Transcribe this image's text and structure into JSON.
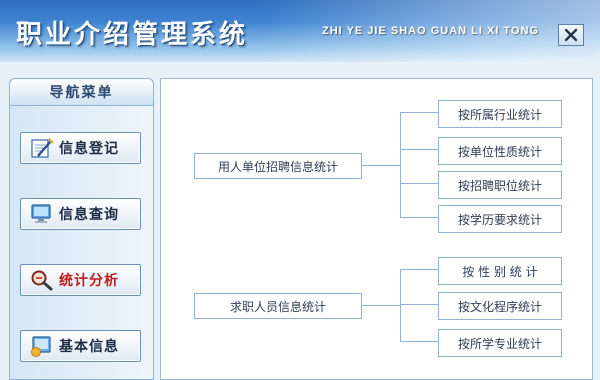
{
  "header": {
    "title": "职业介绍管理系统",
    "subtitle": "ZHI YE JIE SHAO GUAN LI XI TONG"
  },
  "sidebar": {
    "heading": "导航菜单",
    "items": [
      {
        "label": "信息登记",
        "icon": "register-icon"
      },
      {
        "label": "信息查询",
        "icon": "computer-icon"
      },
      {
        "label": "统计分析",
        "icon": "magnifier-icon",
        "active": true
      },
      {
        "label": "基本信息",
        "icon": "info-icon"
      }
    ]
  },
  "tree": {
    "employer": {
      "label": "用人单位招聘信息统计",
      "children": [
        "按所属行业统计",
        "按单位性质统计",
        "按招聘职位统计",
        "按学历要求统计"
      ]
    },
    "seeker": {
      "label": "求职人员信息统计",
      "children": [
        "按 性 别 统 计",
        "按文化程序统计",
        "按所学专业统计"
      ]
    }
  },
  "colors": {
    "header_blue": "#2f6fbd",
    "active_label": "#c2181c"
  }
}
